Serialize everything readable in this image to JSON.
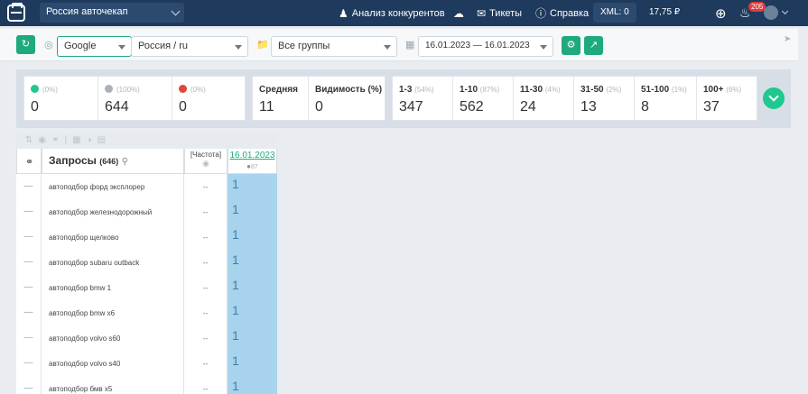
{
  "header": {
    "project": "Россия авточекап",
    "competitors": "Анализ конкурентов",
    "tickets": "Тикеты",
    "help": "Справка",
    "xml": "XML: 0",
    "balance": "17,75 ₽",
    "notifications": "205"
  },
  "filters": {
    "engine": "Google",
    "region": "Россия / ru",
    "groups": "Все группы",
    "date_range": "16.01.2023 — 16.01.2023"
  },
  "stats": {
    "up_pct": "(0%)",
    "up_value": "0",
    "same_pct": "(100%)",
    "same_value": "644",
    "down_pct": "(0%)",
    "down_value": "0",
    "avg_label": "Средняя",
    "avg_value": "11",
    "vis_label": "Видимость (%)",
    "vis_value": "0",
    "ranges": [
      {
        "label": "1-3",
        "pct": "(54%)",
        "value": "347"
      },
      {
        "label": "1-10",
        "pct": "(87%)",
        "value": "562"
      },
      {
        "label": "11-30",
        "pct": "(4%)",
        "value": "24"
      },
      {
        "label": "31-50",
        "pct": "(2%)",
        "value": "13"
      },
      {
        "label": "51-100",
        "pct": "(1%)",
        "value": "8"
      },
      {
        "label": "100+",
        "pct": "(6%)",
        "value": "37"
      }
    ]
  },
  "table": {
    "queries_label": "Запросы",
    "queries_count": "(646)",
    "freq_label": "[Частота]",
    "date": "16.01.2023",
    "date_sub": "87",
    "rows": [
      {
        "query": "автоподбор форд эксплорер",
        "freq": "--",
        "pos": "1"
      },
      {
        "query": "автоподбор железнодорожный",
        "freq": "--",
        "pos": "1"
      },
      {
        "query": "автоподбор щелково",
        "freq": "--",
        "pos": "1"
      },
      {
        "query": "автоподбор subaru outback",
        "freq": "--",
        "pos": "1"
      },
      {
        "query": "автоподбор bmw 1",
        "freq": "--",
        "pos": "1"
      },
      {
        "query": "автоподбор bmw x6",
        "freq": "--",
        "pos": "1"
      },
      {
        "query": "автоподбор volvo s60",
        "freq": "--",
        "pos": "1"
      },
      {
        "query": "автоподбор volvo s40",
        "freq": "--",
        "pos": "1"
      },
      {
        "query": "автоподбор бмв x5",
        "freq": "--",
        "pos": "1"
      }
    ]
  }
}
